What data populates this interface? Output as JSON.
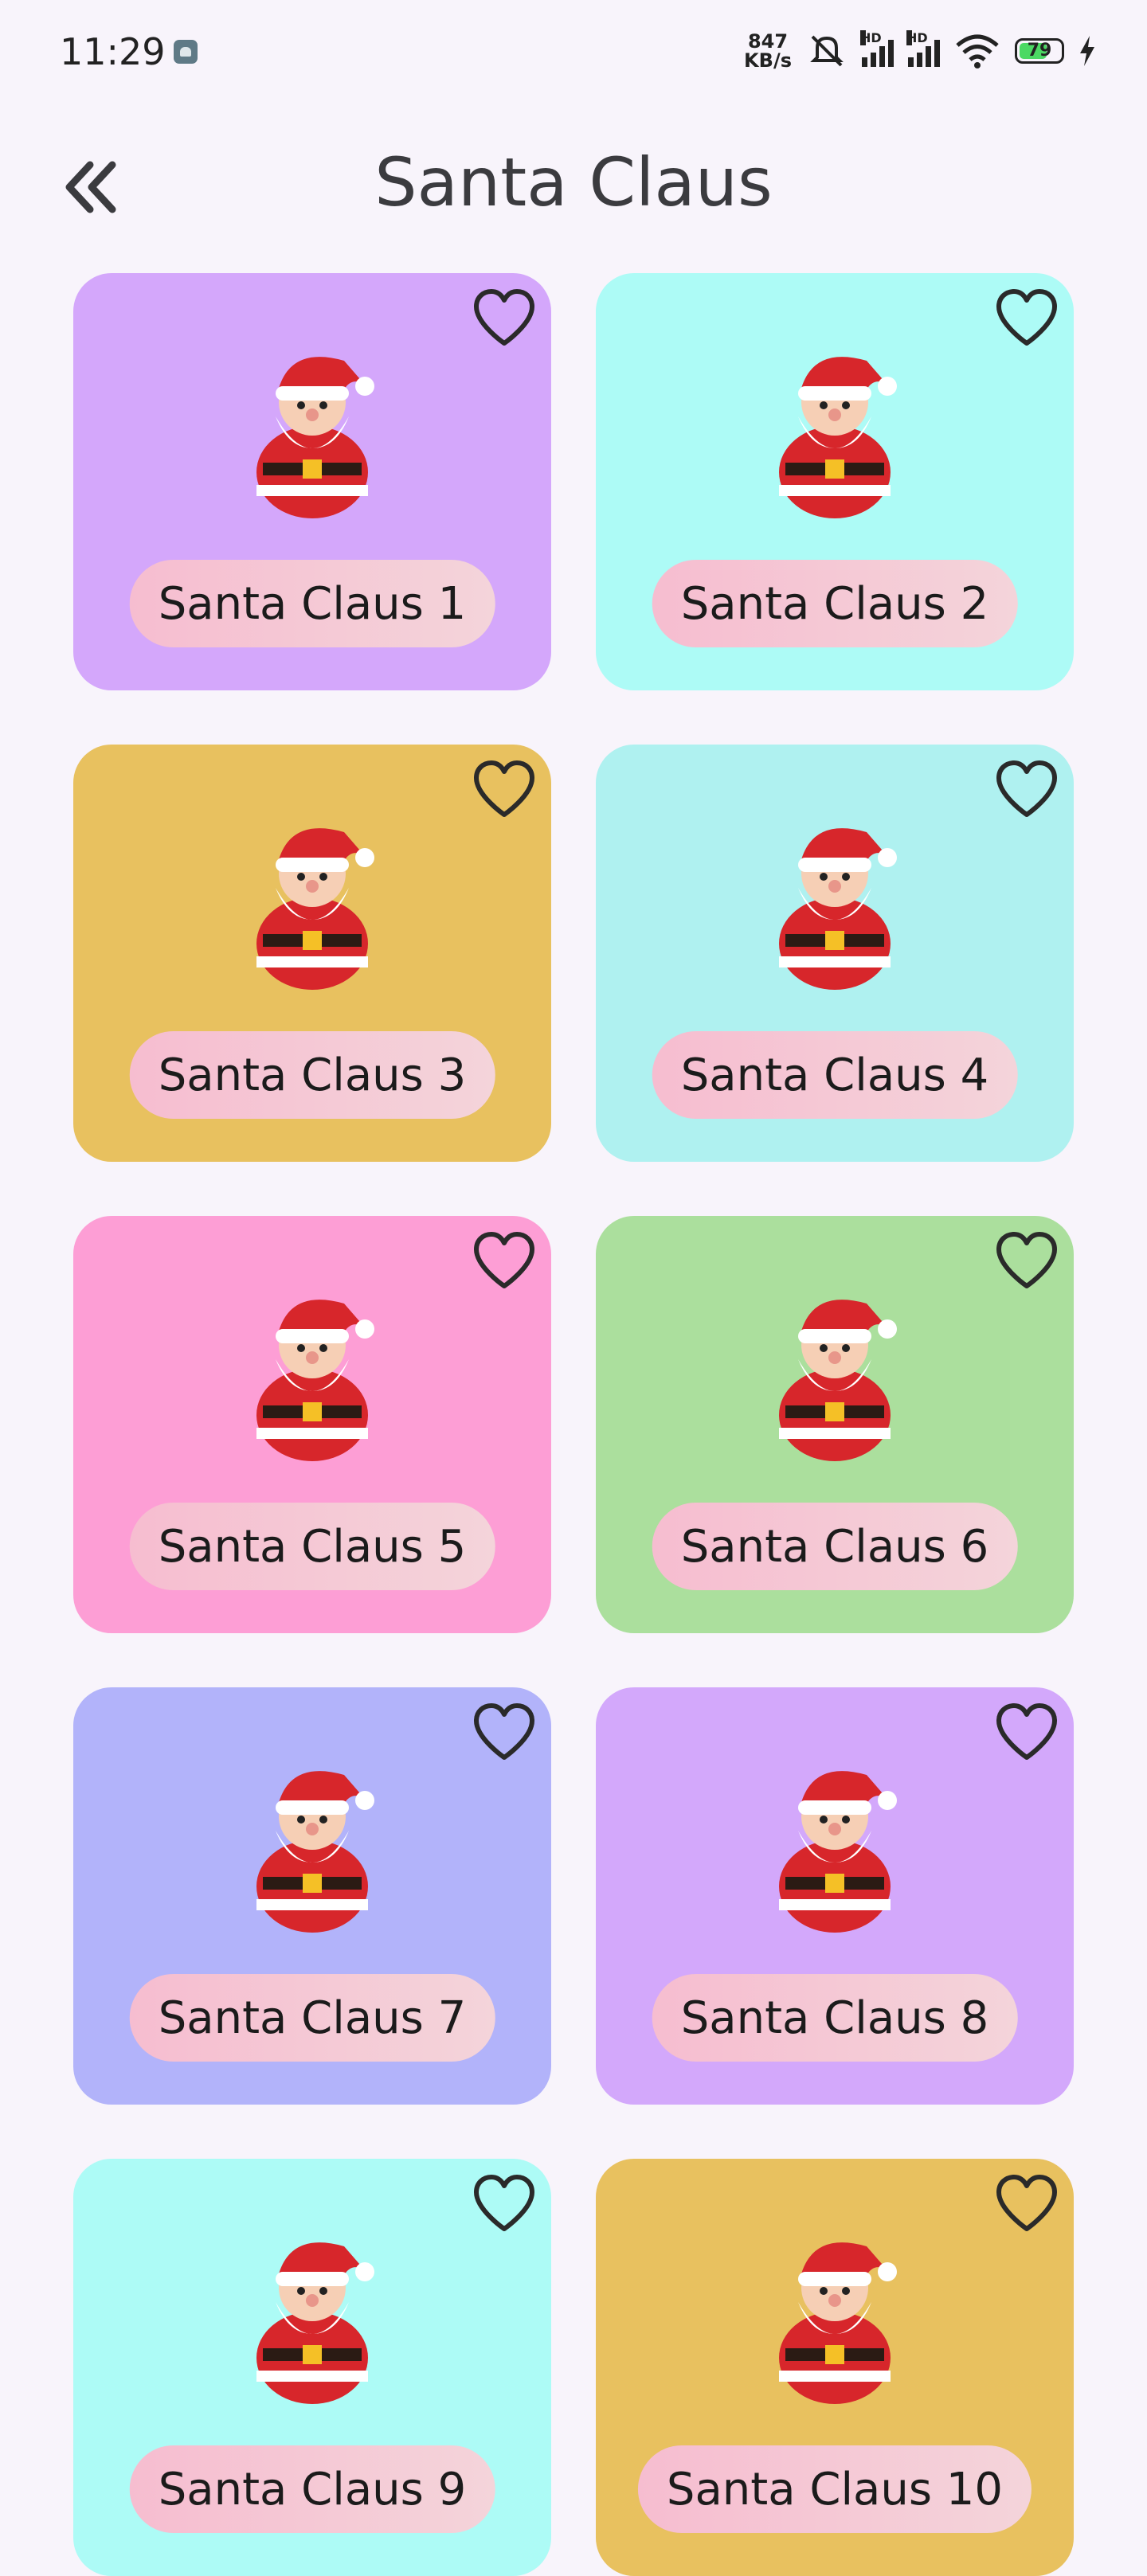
{
  "status": {
    "time": "11:29",
    "net_speed_top": "847",
    "net_speed_bottom": "KB/s",
    "battery": "79",
    "hd1": "HD",
    "hd2": "HD"
  },
  "header": {
    "title": "Santa Claus"
  },
  "cards": [
    {
      "label": "Santa Claus 1",
      "bg": "#d4a7fb"
    },
    {
      "label": "Santa Claus 2",
      "bg": "#adfbf6"
    },
    {
      "label": "Santa Claus 3",
      "bg": "#e8c15f"
    },
    {
      "label": "Santa Claus 4",
      "bg": "#aff1f0"
    },
    {
      "label": "Santa Claus 5",
      "bg": "#fd9ed5"
    },
    {
      "label": "Santa Claus 6",
      "bg": "#abdf9d"
    },
    {
      "label": "Santa Claus 7",
      "bg": "#b2b3fa"
    },
    {
      "label": "Santa Claus 8",
      "bg": "#d3a8fb"
    },
    {
      "label": "Santa Claus 9",
      "bg": "#adfbf6"
    },
    {
      "label": "Santa Claus 10",
      "bg": "#e8c15f"
    }
  ],
  "icons": {
    "back": "double-chevron-left-icon",
    "favorite": "heart-outline-icon"
  }
}
